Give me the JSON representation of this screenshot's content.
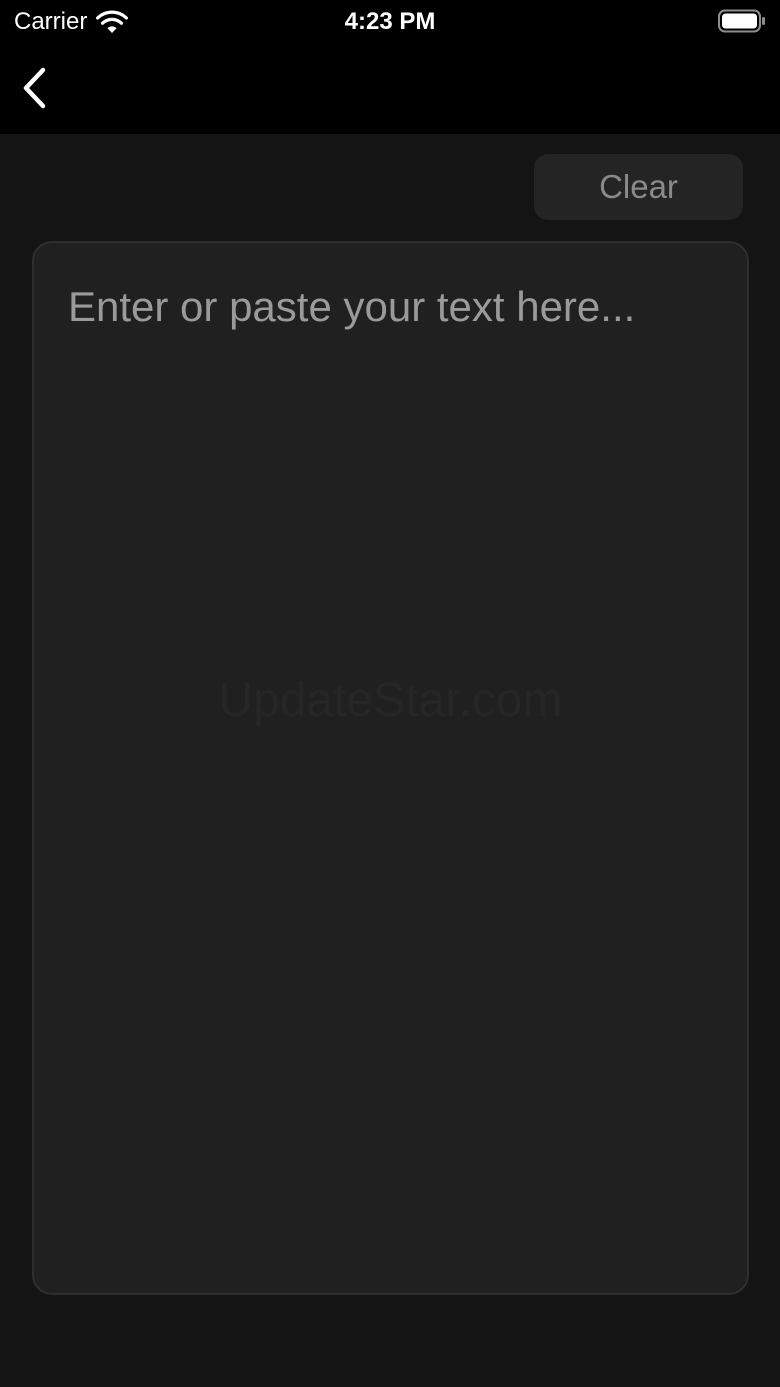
{
  "status_bar": {
    "carrier": "Carrier",
    "time": "4:23 PM",
    "icons": [
      "wifi-icon",
      "battery-icon"
    ]
  },
  "nav_bar": {
    "back_icon": "chevron-left-icon"
  },
  "toolbar": {
    "clear_label": "Clear"
  },
  "editor": {
    "value": "",
    "placeholder": "Enter or paste your text here..."
  },
  "watermark": {
    "text": "UpdateStar.com"
  },
  "colors": {
    "background": "#141414",
    "bars": "#000000",
    "editor_bg": "#202020",
    "button_bg": "#242424",
    "button_text": "#8a8a8a",
    "placeholder": "#9a9a9a"
  }
}
